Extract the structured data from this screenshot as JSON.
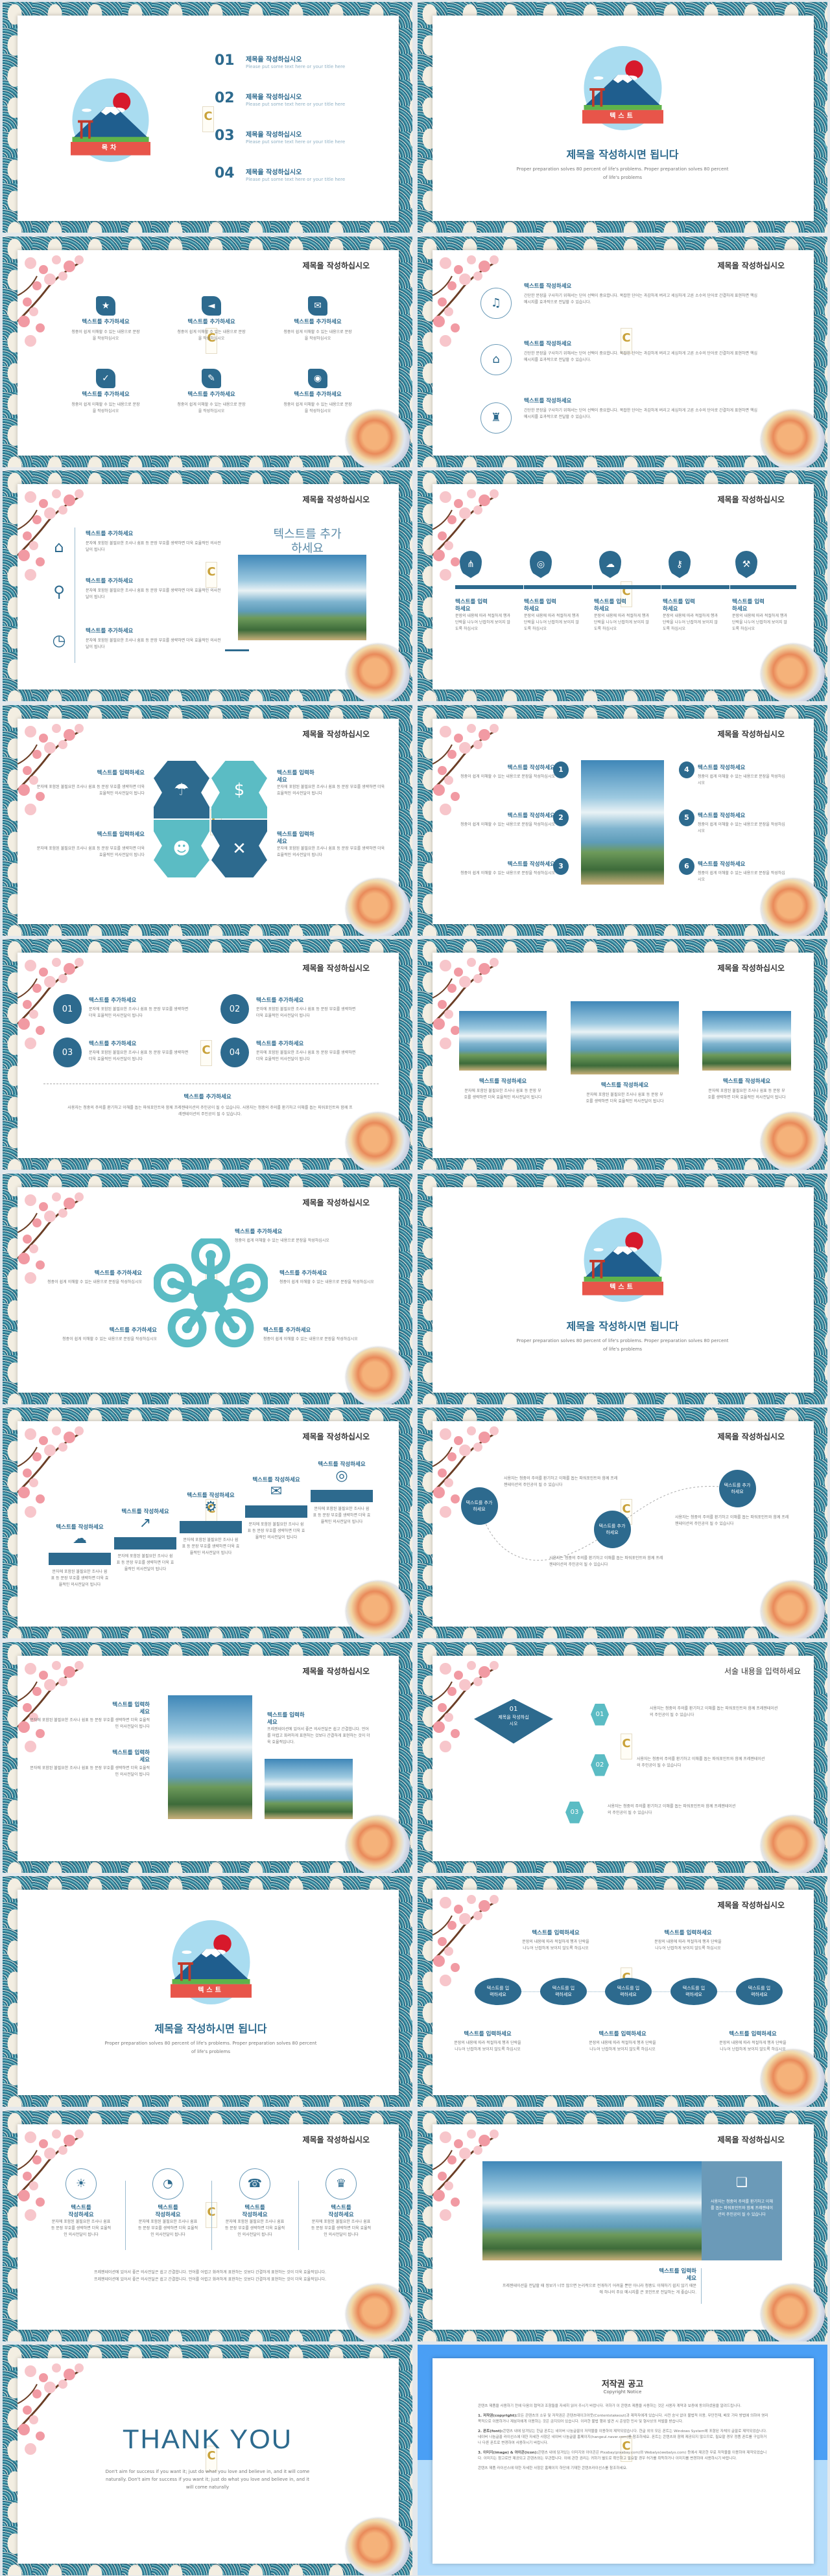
{
  "colors": {
    "primary": "#2d6a8e",
    "teal": "#5bbcc4",
    "ribbon": "#e8554a",
    "sun": "#d7192b"
  },
  "common": {
    "slide_title": "제목을 작성하십시오"
  },
  "toc": {
    "ribbon": "목차",
    "items": [
      {
        "num": "01",
        "title": "제목을 작성하십시오",
        "sub": "Please put some text here or your title here"
      },
      {
        "num": "02",
        "title": "제목을 작성하십시오",
        "sub": "Please put some text here or your title here"
      },
      {
        "num": "03",
        "title": "제목을 작성하십시오",
        "sub": "Please put some text here or your title here"
      },
      {
        "num": "04",
        "title": "제목을 작성하십시오",
        "sub": "Please put some text here or your title here"
      }
    ]
  },
  "section": {
    "ribbon": "텍스트",
    "title": "제목을 작성하시면 됩니다",
    "body": "Proper preparation solves 80 percent of life's problems. Proper preparation solves 80 percent of life's problems"
  },
  "s3": {
    "heading": "텍스트를 추가하세요",
    "body": "청중이 쉽게 이해할 수 있는 내용으로 문장을 작성하십시오",
    "icons": [
      "star-icon",
      "megaphone-icon",
      "chat-icon",
      "clipboard-icon",
      "brush-icon",
      "power-icon"
    ]
  },
  "s4": {
    "heading": "텍스트를 작성하세요",
    "body": "간단한 문장을 구사하기 위해서는 단어 선택이 중요합니다. 복잡한 단어는 과감하게 버리고 세심하게 고른 소수의 단어로 간결하게 표현하면 핵심 메시지를 효과적으로 전달할 수 있습니다.",
    "icons": [
      "headphones-icon",
      "house-icon",
      "building-icon"
    ]
  },
  "s5": {
    "heading": "텍스트를 추가하세요",
    "body": "문자에 포함된 불필요한 조사나 쉼표 등 문장 부호를 생략하면 더욱 효율적인 의사전달이 됩니다",
    "big": "텍스트를 추가하세요",
    "icons": [
      "house-icon",
      "search-icon",
      "alarm-icon"
    ]
  },
  "s6": {
    "heading": "텍스트를 입력하세요",
    "body": "문장의 내용에 따라 적절하게 행과 단락을 나누어 난잡하게 보이지 않도록 하십시오",
    "icons": [
      "network-icon",
      "lifebuoy-icon",
      "cloud-upload-icon",
      "key-icon",
      "tools-icon"
    ]
  },
  "s7": {
    "heading": "텍스트를 입력하세요",
    "body": "문자에 포함된 불필요한 조사나 쉼표 등 문장 부호를 생략하면 더욱 효율적인 의사전달이 됩니다",
    "icons": [
      "cloud-rain-icon",
      "dollar-icon",
      "people-icon",
      "arrows-icon"
    ]
  },
  "s8": {
    "heading": "텍스트를 작성하세요",
    "body": "청중이 쉽게 이해할 수 있는 내용으로 문장을 작성하십시오",
    "nums": [
      "1",
      "2",
      "3",
      "4",
      "5",
      "6"
    ]
  },
  "s9": {
    "heading": "텍스트를 추가하세요",
    "body": "문자에 포함된 불필요한 조사나 쉼표 등 문장 부호를 생략하면 더욱 효율적인 의사전달이 됩니다",
    "nums": [
      "01",
      "02",
      "03",
      "04"
    ],
    "bottom_heading": "텍스트를 추가하세요",
    "bottom_body": "사용자는 청중의 주의를 환기하고 이해를 돕는 파워포인트와 함께 프레젠테이션의 주인공이 될 수 있습니다. 사용자는 청중의 주의를 환기하고 이해를 돕는 파워포인트와 함께 프레젠테이션의 주인공이 될 수 있습니다."
  },
  "s10": {
    "heading": "텍스트를 작성하세요",
    "body": "문자에 포함된 불필요한 조사나 쉼표 등 문장 부호를 생략하면 더욱 효율적인 의사전달이 됩니다"
  },
  "s11": {
    "heading": "텍스트를 추가하세요",
    "body": "청중이 쉽게 이해할 수 있는 내용으로 문장을 작성하십시오"
  },
  "s13": {
    "heading": "텍스트를 작성하세요",
    "body": "문자에 포함된 불필요한 조사나 쉼표 등 문장 부호를 생략하면 더욱 효율적인 의사전달이 됩니다",
    "icons": [
      "cloud-upload-icon",
      "chart-icon",
      "gears-icon",
      "chat-icon",
      "lifebuoy-icon"
    ]
  },
  "s14": {
    "circle": "텍스트를 추가하세요",
    "body": "사용자는 청중의 주의를 환기하고 이해를 돕는 파워포인트와 함께 프레젠테이션의 주인공이 될 수 있습니다"
  },
  "s15": {
    "heading": "텍스트를 입력하세요",
    "body": "문자에 포함된 불필요한 조사나 쉼표 등 문장 부호를 생략하면 더욱 효율적인 의사전달이 됩니다",
    "right_body": "프레젠테이션에 있어서 좋은 의사전달은 쉽고 간결합니다. 언어를 어렵고 화려하게 표현하는 것보다 간결하게 표현하는 것이 더욱 효율적입니다."
  },
  "s16": {
    "title": "서술 내용을 입력하세요",
    "main_num": "01",
    "main_title": "제목을 작성하십시오",
    "nums": [
      "01",
      "02",
      "03"
    ],
    "body": "사용자는 청중의 주의를 환기하고 이해를 돕는 파워포인트와 함께 프레젠테이션의 주인공이 될 수 있습니다"
  },
  "s18": {
    "circle": "텍스트를 입력하세요",
    "heading": "텍스트를 입력하세요",
    "body": "문장의 내용에 따라 적절하게 행과 단락을 나누어 난잡하게 보이지 않도록 하십시오"
  },
  "s19": {
    "heading": "텍스트를 작성하세요",
    "body": "문자에 포함된 불필요한 조사나 쉼표 등 문장 부호를 생략하면 더욱 효율적인 의사전달이 됩니다",
    "bottom": "프레젠테이션에 있어서 좋은 의사전달은 쉽고 간결합니다. 언어를 어렵고 화려하게 표현하는 것보다 간결하게 표현하는 것이 더욱 효율적입니다.",
    "icons": [
      "bulb-icon",
      "pie-chart-icon",
      "phone-24h-icon",
      "trophy-icon"
    ]
  },
  "s20": {
    "panel_text": "사용자는 청중의 주의를 환기하고 이해를 돕는 파워포인트와 함께 프레젠테이션의 주인공이 될 수 있습니다",
    "heading": "텍스트를 입력하세요",
    "body": "프레젠테이션을 전달할 때 정보가 너무 많으면 논리적으로 전개하기 어려울 뿐만 아니라 청중도 이해하기 쉽지 않기 때문에 하나의 주요 메시지를 큰 포인트로 전달하는 게 좋습니다.",
    "icon": "book-icon"
  },
  "thanks": {
    "title": "THANK YOU",
    "body": "Don't aim for success if you want it; just do what you love and believe in, and it will come naturally. Don't aim for success if you want it; just do what you love and believe in, and it will come naturally"
  },
  "copyright": {
    "title": "저작권 공고",
    "sub": "Copyright Notice",
    "intro": "콘텐츠 제품을 사용하기 전에 다음의 협약과 조항들을 자세히 읽어 주시기 바랍니다. 귀하가 이 콘텐츠 제품을 사용하는 것은 사용자 계약과 보증에 동의하셨음을 알려드립니다.",
    "sections": [
      {
        "label": "1. 저작권(copyright):",
        "text": "모든 콘텐츠의 소유 및 저작권은 콘텐츠테이크아웃(Contentstakeout)과 제작자에게 있습니다. 사전 승낙 없이 불법적 이용, 무단전재, 배포 기타 방법에 의하여 영리 목적으로 이용하거나 제삼자에게 이용하는 것은 금지되어 있습니다. 이러한 불법 행위 발견 시 준엄한 민사 및 형사상의 처벌을 받습니다."
      },
      {
        "label": "2. 폰트(font):",
        "text": "콘텐츠 내에 담겨있는 한글 폰트는 네이버 나눔글꼴의 저작물을 이용하여 제작되었습니다. 한글 외의 모든 폰트는 Windows System에 포함된 자체의 글꼴로 제작되었습니다. 네이버 나눔글꼴 라이선스에 대한 자세한 사항은 네이버 나눔글꼴 홈페이지(hangeul.naver.com)를 참조하세요. 폰트는 콘텐츠와 함께 제공되지 않으므로, 필요할 경우 정품 폰트를 구입하거나 다른 폰트로 변경하여 사용하시기 바랍니다."
      },
      {
        "label": "3. 이미지(image) & 아이콘(icon):",
        "text": "콘텐츠 내에 담겨있는 이미지와 아이콘은 Pixabay(pixabay.com)와 Webalys(webalys.com) 등에서 제공한 무료 저작물을 이용하여 제작되었습니다. 이미지는 참고로만 제공되고 콘텐츠와는 무관합니다. 이에 관한 권리는 귀하가 별도로 확인하고 필요할 경우 허가를 취득하거나 이미지를 변경하여 사용하시기 바랍니다."
      }
    ],
    "outro": "콘텐츠 제품 라이선스에 대한 자세한 사항은 홈페이지 하단에 기재한 콘텐츠라이선스를 참조하세요."
  }
}
